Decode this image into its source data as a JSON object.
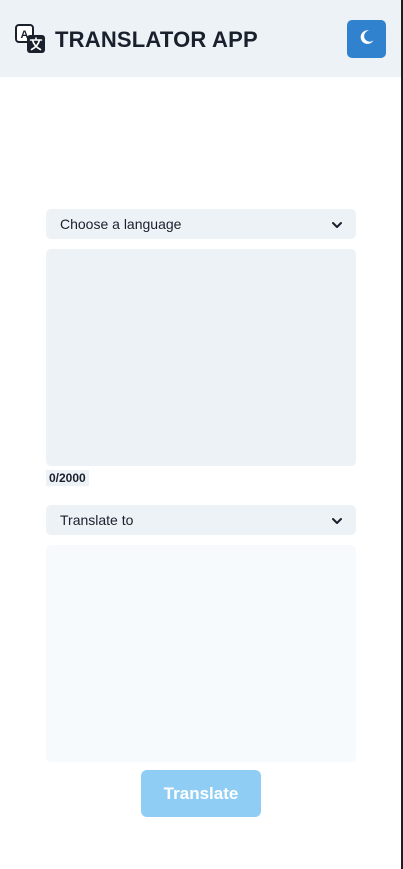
{
  "app": {
    "title": "TRANSLATOR APP",
    "logo_icon": "translate-icon",
    "theme_toggle_icon": "moon-icon"
  },
  "source": {
    "language_select": {
      "selected": "Choose a language",
      "icon": "chevron-down-icon"
    },
    "textarea": {
      "value": "",
      "placeholder": ""
    },
    "char_count": "0/2000"
  },
  "target": {
    "language_select": {
      "selected": "Translate to",
      "icon": "chevron-down-icon"
    },
    "textarea": {
      "value": "",
      "placeholder": ""
    }
  },
  "actions": {
    "translate_label": "Translate"
  },
  "colors": {
    "header_bg": "#edf2f7",
    "accent": "#3182ce",
    "button_disabled": "#90cdf4",
    "field_bg": "#edf2f7",
    "output_bg": "#f7fafc",
    "text": "#1a202c"
  }
}
